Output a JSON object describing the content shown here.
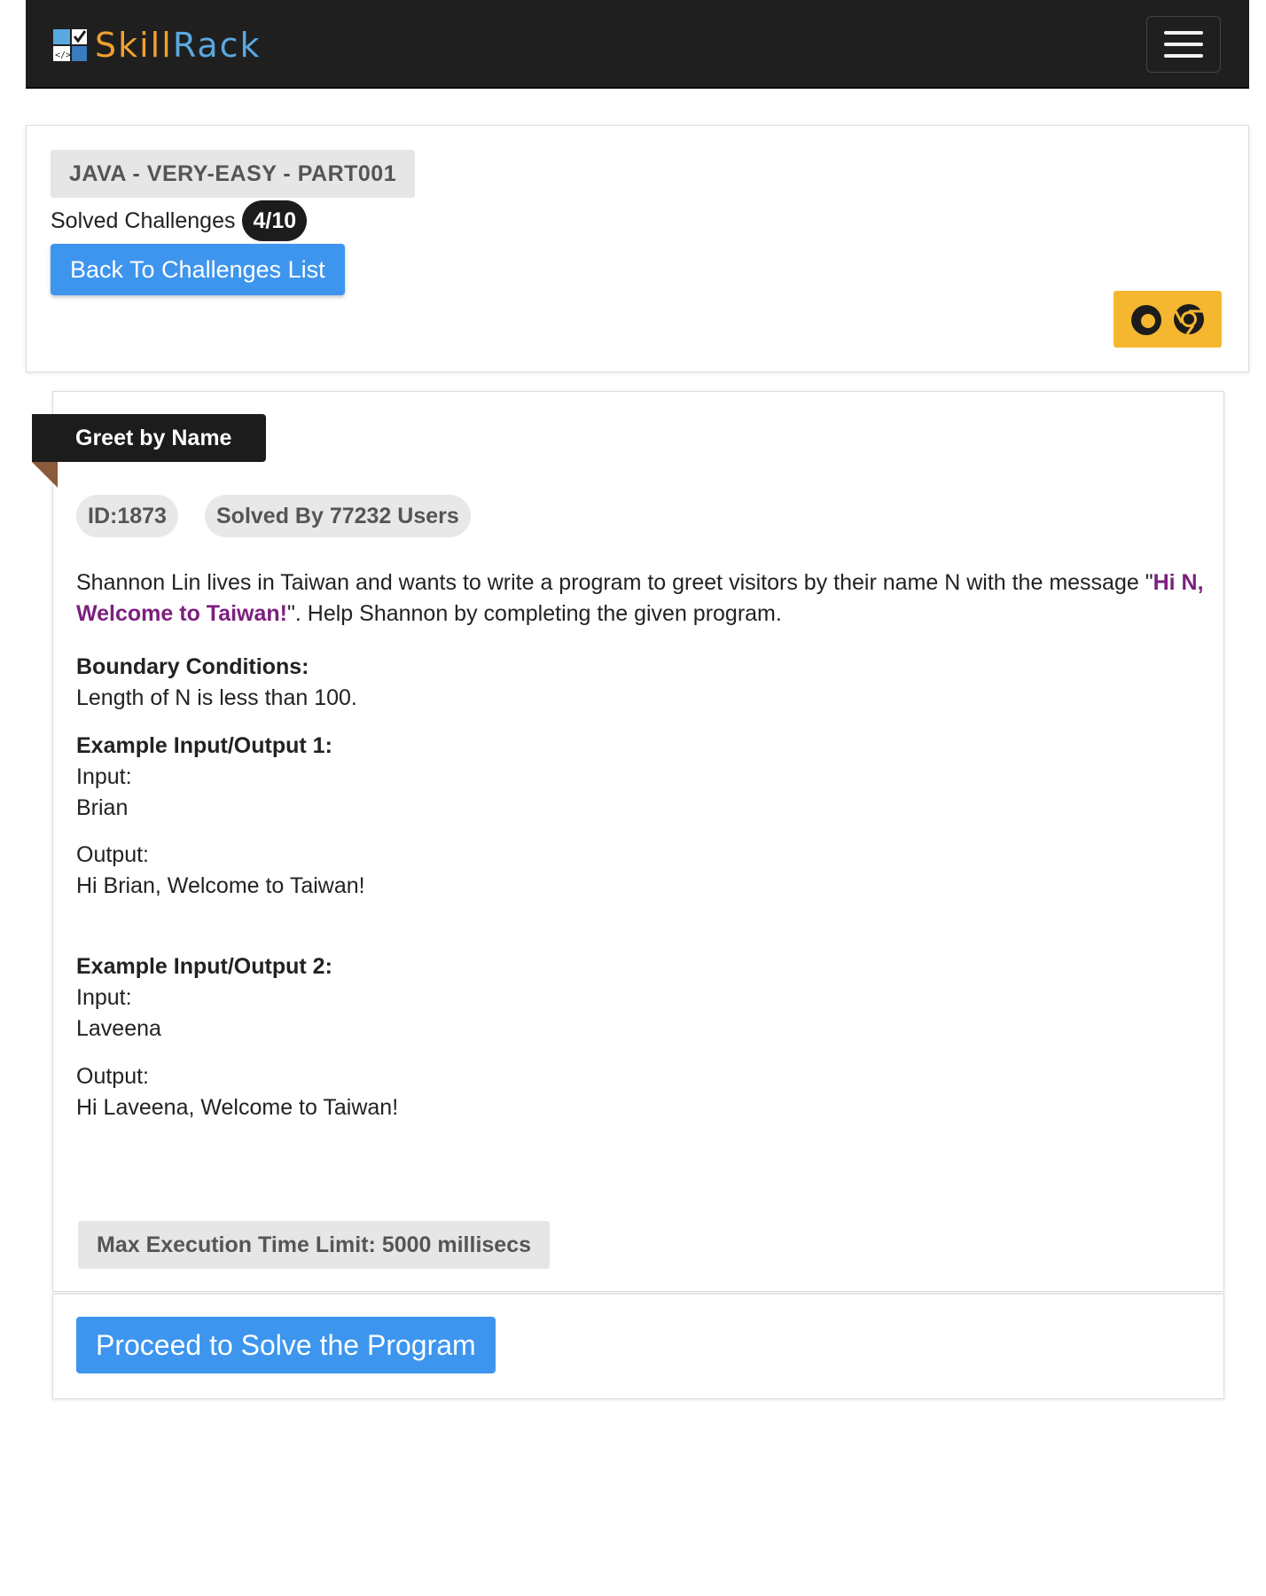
{
  "navbar": {
    "logo_part1": "Skill",
    "logo_part2": "Rack",
    "menu_icon": "hamburger-menu-icon",
    "colors": {
      "background": "#1f1f1f",
      "logo_orange": "#f0a030",
      "logo_blue": "#5aa8e0"
    }
  },
  "course": {
    "title": "JAVA - VERY-EASY - PART001",
    "solved_label": "Solved Challenges",
    "solved_count": "4/10",
    "back_button": "Back To Challenges List",
    "browser_icons": [
      "firefox-icon",
      "chrome-icon"
    ]
  },
  "challenge": {
    "title": "Greet by Name",
    "id_label": "ID:1873",
    "solved_by": "Solved By 77232 Users",
    "description_part1": "Shannon Lin lives in Taiwan and wants to write a program to greet visitors by their name N with the message \"",
    "description_highlight": "Hi N, Welcome to Taiwan!",
    "description_part2": "\". Help Shannon by completing the given program.",
    "boundary_heading": "Boundary Conditions:",
    "boundary_text": "Length of N is less than 100.",
    "examples": [
      {
        "heading": "Example Input/Output 1:",
        "input_label": "Input:",
        "input": "Brian",
        "output_label": "Output:",
        "output": "Hi Brian, Welcome to Taiwan!"
      },
      {
        "heading": "Example Input/Output 2:",
        "input_label": "Input:",
        "input": "Laveena",
        "output_label": "Output:",
        "output": "Hi Laveena, Welcome to Taiwan!"
      }
    ],
    "time_limit": "Max Execution Time Limit: 5000 millisecs",
    "proceed_button": "Proceed to Solve the Program"
  },
  "colors": {
    "primary_button": "#3d95ee",
    "highlight_text": "#7b1f7e",
    "browser_box": "#f5b730",
    "ribbon": "#1c1c1c"
  }
}
